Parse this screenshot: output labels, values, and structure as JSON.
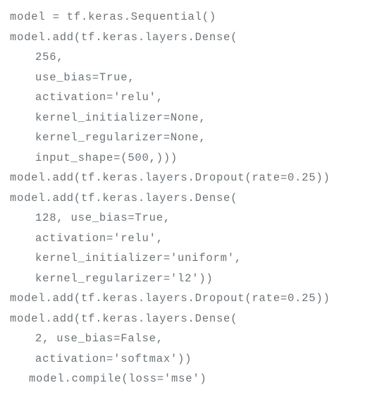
{
  "code": {
    "lines": [
      {
        "text": "model = tf.keras.Sequential()",
        "indent": ""
      },
      {
        "text": "model.add(tf.keras.layers.Dense(",
        "indent": ""
      },
      {
        "text": "256,",
        "indent": "indent-1"
      },
      {
        "text": "use_bias=True,",
        "indent": "indent-1"
      },
      {
        "text": "activation='relu',",
        "indent": "indent-1"
      },
      {
        "text": "kernel_initializer=None,",
        "indent": "indent-1"
      },
      {
        "text": "kernel_regularizer=None,",
        "indent": "indent-1"
      },
      {
        "text": "input_shape=(500,)))",
        "indent": "indent-1"
      },
      {
        "text": "model.add(tf.keras.layers.Dropout(rate=0.25))",
        "indent": ""
      },
      {
        "text": "model.add(tf.keras.layers.Dense(",
        "indent": ""
      },
      {
        "text": "128, use_bias=True,",
        "indent": "indent-1"
      },
      {
        "text": "activation='relu',",
        "indent": "indent-1"
      },
      {
        "text": "kernel_initializer='uniform',",
        "indent": "indent-1"
      },
      {
        "text": "kernel_regularizer='l2'))",
        "indent": "indent-1"
      },
      {
        "text": "model.add(tf.keras.layers.Dropout(rate=0.25))",
        "indent": ""
      },
      {
        "text": "model.add(tf.keras.layers.Dense(",
        "indent": ""
      },
      {
        "text": "2, use_bias=False,",
        "indent": "indent-1"
      },
      {
        "text": "activation='softmax'))",
        "indent": "indent-1"
      },
      {
        "text": "model.compile(loss='mse')",
        "indent": "indent-special"
      }
    ]
  }
}
